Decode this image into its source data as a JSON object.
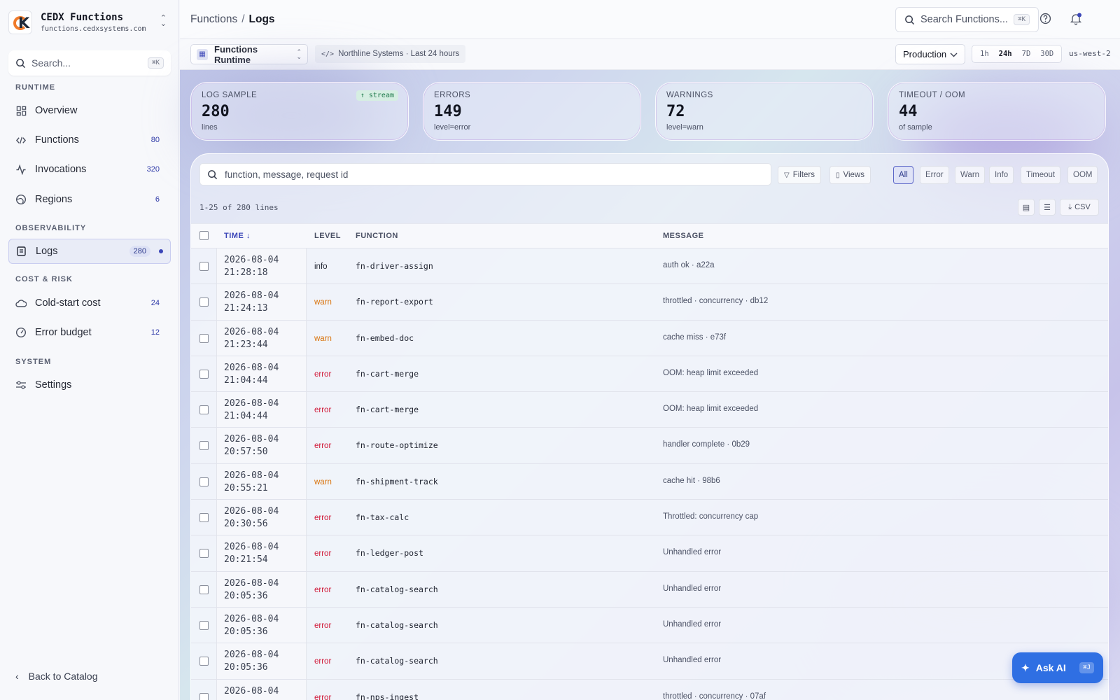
{
  "brand": {
    "title": "CEDX Functions",
    "subtitle": "functions.cedxsystems.com"
  },
  "sidebar": {
    "search": {
      "placeholder": "Search...",
      "shortcut": "⌘K"
    },
    "sections": [
      {
        "label": "RUNTIME"
      },
      {
        "label": "OBSERVABILITY"
      },
      {
        "label": "COST & RISK"
      },
      {
        "label": "SYSTEM"
      }
    ],
    "items": [
      {
        "label": "Overview",
        "count": ""
      },
      {
        "label": "Functions",
        "count": "80"
      },
      {
        "label": "Invocations",
        "count": "320"
      },
      {
        "label": "Regions",
        "count": "6"
      },
      {
        "label": "Logs",
        "count": "280"
      },
      {
        "label": "Cold-start cost",
        "count": "24"
      },
      {
        "label": "Error budget",
        "count": "12"
      },
      {
        "label": "Settings",
        "count": ""
      }
    ],
    "back_label": "Back to Catalog"
  },
  "header": {
    "breadcrumb_parent": "Functions",
    "breadcrumb_sep": "/",
    "breadcrumb_current": "Logs",
    "search_placeholder": "Search Functions...",
    "search_shortcut": "⌘K"
  },
  "subbar": {
    "runtime_label": "Functions Runtime",
    "context_label": "Northline Systems · Last 24 hours",
    "environment": "Production",
    "ranges": [
      "1h",
      "24h",
      "7D",
      "30D"
    ],
    "selected_range": "24h",
    "region": "us-west-2"
  },
  "stats": [
    {
      "title": "LOG SAMPLE",
      "value": "280",
      "sub": "lines",
      "badge": "stream"
    },
    {
      "title": "ERRORS",
      "value": "149",
      "sub": "level=error"
    },
    {
      "title": "WARNINGS",
      "value": "72",
      "sub": "level=warn"
    },
    {
      "title": "TIMEOUT / OOM",
      "value": "44",
      "sub": "of sample"
    }
  ],
  "logs": {
    "search_placeholder": "function, message, request id",
    "filters_label": "Filters",
    "views_label": "Views",
    "levels": [
      "All",
      "Error",
      "Warn",
      "Info",
      "Timeout",
      "OOM"
    ],
    "selected_level": "All",
    "range_text": "1-25 of 280 lines",
    "csv_label": "CSV",
    "columns": [
      "TIME",
      "LEVEL",
      "FUNCTION",
      "MESSAGE"
    ],
    "rows": [
      {
        "date": "2026-08-04",
        "time": "21:28:18",
        "level": "info",
        "function": "fn-driver-assign",
        "message": "auth ok · a22a"
      },
      {
        "date": "2026-08-04",
        "time": "21:24:13",
        "level": "warn",
        "function": "fn-report-export",
        "message": "throttled · concurrency · db12"
      },
      {
        "date": "2026-08-04",
        "time": "21:23:44",
        "level": "warn",
        "function": "fn-embed-doc",
        "message": "cache miss · e73f"
      },
      {
        "date": "2026-08-04",
        "time": "21:04:44",
        "level": "error",
        "function": "fn-cart-merge",
        "message": "OOM: heap limit exceeded"
      },
      {
        "date": "2026-08-04",
        "time": "21:04:44",
        "level": "error",
        "function": "fn-cart-merge",
        "message": "OOM: heap limit exceeded"
      },
      {
        "date": "2026-08-04",
        "time": "20:57:50",
        "level": "error",
        "function": "fn-route-optimize",
        "message": "handler complete · 0b29"
      },
      {
        "date": "2026-08-04",
        "time": "20:55:21",
        "level": "warn",
        "function": "fn-shipment-track",
        "message": "cache hit · 98b6"
      },
      {
        "date": "2026-08-04",
        "time": "20:30:56",
        "level": "error",
        "function": "fn-tax-calc",
        "message": "Throttled: concurrency cap"
      },
      {
        "date": "2026-08-04",
        "time": "20:21:54",
        "level": "error",
        "function": "fn-ledger-post",
        "message": "Unhandled error"
      },
      {
        "date": "2026-08-04",
        "time": "20:05:36",
        "level": "error",
        "function": "fn-catalog-search",
        "message": "Unhandled error"
      },
      {
        "date": "2026-08-04",
        "time": "20:05:36",
        "level": "error",
        "function": "fn-catalog-search",
        "message": "Unhandled error"
      },
      {
        "date": "2026-08-04",
        "time": "20:05:36",
        "level": "error",
        "function": "fn-catalog-search",
        "message": "Unhandled error"
      },
      {
        "date": "2026-08-04",
        "time": "",
        "level": "error",
        "function": "fn-nps-ingest",
        "message": "throttled · concurrency · 07af"
      }
    ]
  },
  "ask_ai": {
    "label": "Ask AI",
    "shortcut": "⌘J"
  },
  "colors": {
    "accent": "#3b46b8",
    "warn": "#d9720a",
    "error": "#d11a3a",
    "ask_ai": "#2f6fe3"
  }
}
